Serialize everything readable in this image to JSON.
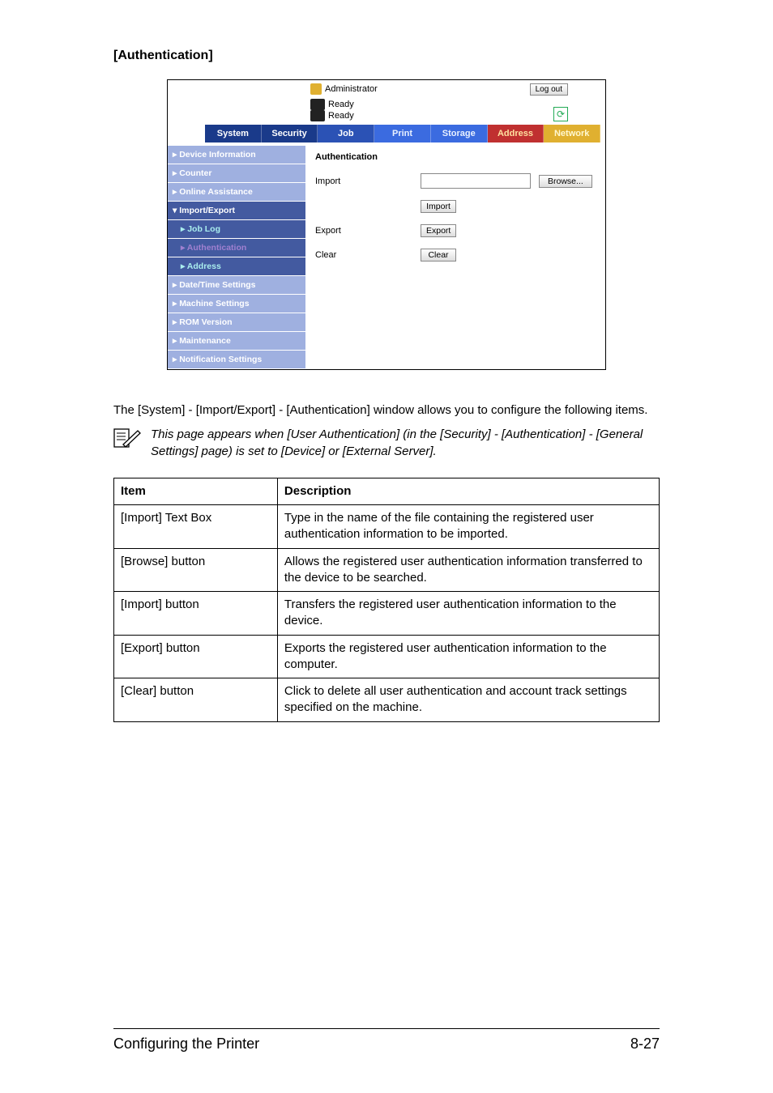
{
  "heading": "[Authentication]",
  "screenshot": {
    "admin_label": "Administrator",
    "logout": "Log out",
    "ready1": "Ready",
    "ready2": "Ready",
    "tabs": {
      "system": "System",
      "security": "Security",
      "job": "Job",
      "print": "Print",
      "storage": "Storage",
      "address": "Address",
      "network": "Network"
    },
    "sidebar": {
      "device_info": "▸ Device Information",
      "counter": "▸ Counter",
      "online_assist": "▸ Online Assistance",
      "import_export": "▾ Import/Export",
      "job_log": "▸ Job Log",
      "auth": "▸ Authentication",
      "address": "▸ Address",
      "date_time": "▸ Date/Time Settings",
      "machine": "▸ Machine Settings",
      "rom": "▸ ROM Version",
      "maintenance": "▸ Maintenance",
      "notification": "▸ Notification Settings"
    },
    "content": {
      "title": "Authentication",
      "import_label": "Import",
      "browse_btn": "Browse...",
      "import_btn": "Import",
      "export_label": "Export",
      "export_btn": "Export",
      "clear_label": "Clear",
      "clear_btn": "Clear"
    }
  },
  "para": "The [System] - [Import/Export] - [Authentication] window allows you to configure the following items.",
  "note": "This page appears when [User Authentication] (in the [Security] - [Authentication] - [General Settings] page) is set to [Device] or [External Server].",
  "table": {
    "head_item": "Item",
    "head_desc": "Description",
    "rows": [
      {
        "item": "[Import] Text Box",
        "desc": "Type in the name of the file containing the registered user authentication information to be imported."
      },
      {
        "item": "[Browse] button",
        "desc": "Allows the registered user authentication information transferred to the device to be searched."
      },
      {
        "item": "[Import] button",
        "desc": "Transfers the registered user authentication information to the device."
      },
      {
        "item": "[Export] button",
        "desc": "Exports the registered user authentication information to the computer."
      },
      {
        "item": "[Clear] button",
        "desc": "Click to delete all user authentication and account track settings specified on the machine."
      }
    ]
  },
  "footer": {
    "left": "Configuring the Printer",
    "right": "8-27"
  }
}
